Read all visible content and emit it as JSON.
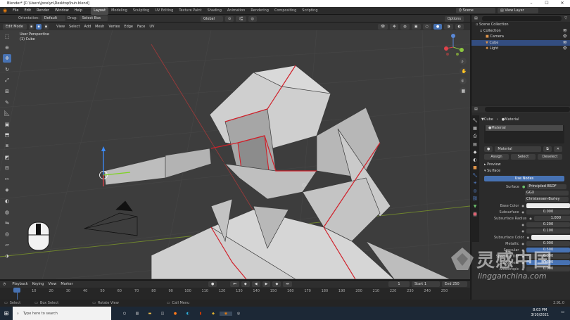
{
  "window": {
    "title": "Blender* [C:\\Users\\Jocelyn\\Desktop\\huh.blend]",
    "controls": [
      "–",
      "☐",
      "✕"
    ]
  },
  "menu": {
    "items": [
      "File",
      "Edit",
      "Render",
      "Window",
      "Help"
    ],
    "workspace_tabs": [
      "Layout",
      "Modeling",
      "Sculpting",
      "UV Editing",
      "Texture Paint",
      "Shading",
      "Animation",
      "Rendering",
      "Compositing",
      "Scripting"
    ],
    "active_tab": "Layout",
    "scene_label": "Scene",
    "view_layer_label": "View Layer"
  },
  "viewport_header": {
    "orientation_label": "Orientation:",
    "orientation_value": "Default",
    "drag_label": "Drag:",
    "drag_value": "Select Box",
    "transform_space": "Global",
    "options_label": "Options",
    "mode": "Edit Mode",
    "menus": [
      "View",
      "Select",
      "Add",
      "Mesh",
      "Vertex",
      "Edge",
      "Face",
      "UV"
    ]
  },
  "viewport": {
    "view_name": "User Perspective",
    "object_name": "(1) Cube",
    "gizmo_axes": [
      "X",
      "Y",
      "Z"
    ],
    "colors": {
      "background": "#3d3d3d",
      "mesh_face": "#c8c8c8",
      "seam": "#d0202a",
      "grid_line": "#4a4a4a",
      "x_axis": "#9a3a3a",
      "y_axis": "#6c8a2a"
    }
  },
  "toolbar": {
    "tools": [
      "select-box",
      "cursor",
      "move",
      "rotate",
      "scale",
      "transform",
      "annotate",
      "measure",
      "add-cube",
      "extrude",
      "inset",
      "bevel",
      "loop-cut",
      "knife",
      "poly-build",
      "spin",
      "smooth",
      "edge-slide",
      "shrink-fatten",
      "shear",
      "rip-region"
    ],
    "active_index": 2
  },
  "outliner": {
    "title": "Scene Collection",
    "items": [
      {
        "label": "Scene Collection",
        "icon": "collection-icon",
        "depth": 0,
        "selected": false
      },
      {
        "label": "Collection",
        "icon": "collection-icon",
        "depth": 1,
        "selected": false
      },
      {
        "label": "Camera",
        "icon": "camera-icon",
        "depth": 2,
        "selected": false
      },
      {
        "label": "Cube",
        "icon": "mesh-icon",
        "depth": 2,
        "selected": true
      },
      {
        "label": "Light",
        "icon": "light-icon",
        "depth": 2,
        "selected": false
      }
    ]
  },
  "properties": {
    "object_label": "Cube",
    "material_label": "Material",
    "slot_name": "Material",
    "material_name": "Material",
    "buttons": [
      "Assign",
      "Select",
      "Deselect"
    ],
    "sections": [
      "Preview",
      "Surface"
    ],
    "use_nodes": "Use Nodes",
    "surface_label": "Surface",
    "surface_value": "Principled BSDF",
    "distribution": "GGX",
    "subsurface_method": "Christensen-Burley",
    "fields": [
      {
        "label": "Base Color",
        "value": "",
        "kind": "white"
      },
      {
        "label": "Subsurface",
        "value": "0.000",
        "kind": "dark"
      },
      {
        "label": "Subsurface Radius",
        "value": "1.000",
        "kind": "dark"
      },
      {
        "label": "",
        "value": "0.200",
        "kind": "dark"
      },
      {
        "label": "",
        "value": "0.100",
        "kind": "dark"
      },
      {
        "label": "Subsurface Color",
        "value": "",
        "kind": "white"
      },
      {
        "label": "Metallic",
        "value": "0.000",
        "kind": "dark"
      },
      {
        "label": "Specular",
        "value": "0.500",
        "kind": "blue"
      },
      {
        "label": "Specular Tint",
        "value": "0.000",
        "kind": "dark"
      },
      {
        "label": "Roughness",
        "value": "0.500",
        "kind": "blue"
      },
      {
        "label": "Anisotropic",
        "value": "0.000",
        "kind": "dark"
      }
    ]
  },
  "timeline": {
    "menus": [
      "Playback",
      "Keying",
      "View",
      "Marker"
    ],
    "current_frame": "1",
    "start_label": "Start",
    "start_value": "1",
    "end_label": "End",
    "end_value": "250",
    "ticks": [
      "0",
      "10",
      "20",
      "30",
      "40",
      "50",
      "60",
      "70",
      "80",
      "90",
      "100",
      "110",
      "120",
      "130",
      "140",
      "150",
      "160",
      "170",
      "180",
      "190",
      "200",
      "210",
      "220",
      "230",
      "240",
      "250"
    ]
  },
  "statusbar": {
    "items": [
      "Select",
      "Box Select",
      "Rotate View",
      "Call Menu"
    ],
    "version": "2.91.0"
  },
  "taskbar": {
    "search_placeholder": "Type here to search",
    "time": "8:03 PM",
    "date": "3/10/2021",
    "apps": [
      "task-view-icon",
      "file-explorer-icon",
      "store-icon",
      "firefox-icon",
      "edge-icon",
      "office-icon",
      "pinned-app-icon",
      "blender-icon",
      "python-icon"
    ]
  },
  "watermark": {
    "brand_cn": "灵感中国",
    "brand_url": "lingganchina.com"
  }
}
